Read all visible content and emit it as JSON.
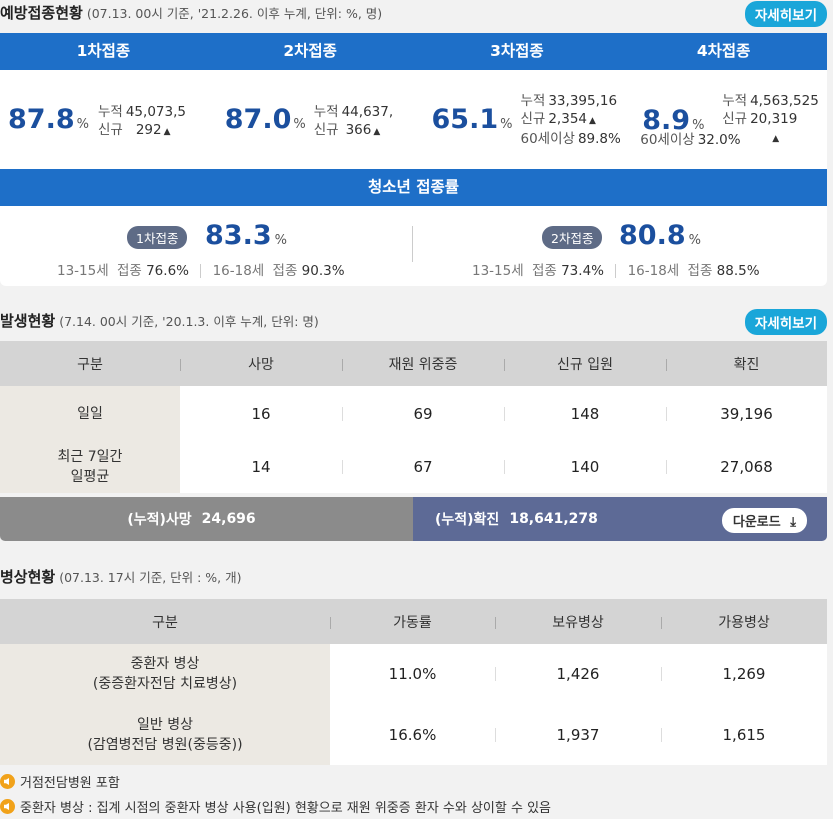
{
  "vaccination": {
    "title": "예방접종현황",
    "note": "(07.13. 00시 기준, '21.2.26. 이후 누계, 단위: %, 명)",
    "detail_btn": "자세히보기",
    "columns": [
      "1차접종",
      "2차접종",
      "3차접종",
      "4차접종"
    ],
    "doses": [
      {
        "rate": "87.8",
        "unit": "%",
        "cum_label": "누적",
        "cum": "45,073,5",
        "new_label": "신규",
        "new": "292"
      },
      {
        "rate": "87.0",
        "unit": "%",
        "cum_label": "누적",
        "cum": "44,637,",
        "new_label": "신규",
        "new": "366"
      },
      {
        "rate": "65.1",
        "unit": "%",
        "cum_label": "누적",
        "cum": "33,395,16",
        "new_label": "신규",
        "new": "2,354",
        "age_label": "60세이상",
        "age": "89.8%"
      },
      {
        "rate": "8.9",
        "unit": "%",
        "cum_label": "누적",
        "cum": "4,563,525",
        "new_label": "신규",
        "new": "20,319",
        "age_label": "60세이상",
        "age": "32.0%"
      }
    ],
    "teen_title": "청소년 접종률",
    "teen": [
      {
        "badge": "1차접종",
        "rate": "83.3",
        "unit": "%",
        "g1_label": "13-15세",
        "g1_kind": "접종",
        "g1": "76.6%",
        "g2_label": "16-18세",
        "g2_kind": "접종",
        "g2": "90.3%"
      },
      {
        "badge": "2차접종",
        "rate": "80.8",
        "unit": "%",
        "g1_label": "13-15세",
        "g1_kind": "접종",
        "g1": "73.4%",
        "g2_label": "16-18세",
        "g2_kind": "접종",
        "g2": "88.5%"
      }
    ]
  },
  "occurrence": {
    "title": "발생현황",
    "note": "(7.14. 00시 기준, '20.1.3. 이후 누계, 단위: 명)",
    "detail_btn": "자세히보기",
    "headers": [
      "구분",
      "사망",
      "재원 위중증",
      "신규 입원",
      "확진"
    ],
    "rows": [
      {
        "label": "일일",
        "values": [
          "16",
          "69",
          "148",
          "39,196"
        ]
      },
      {
        "label": "최근 7일간 일평균",
        "values": [
          "14",
          "67",
          "140",
          "27,068"
        ]
      }
    ],
    "cum_death_label": "(누적)사망",
    "cum_death": "24,696",
    "cum_confirm_label": "(누적)확진",
    "cum_confirm": "18,641,278",
    "download": "다운로드"
  },
  "beds": {
    "title": "병상현황",
    "note": "(07.13. 17시 기준, 단위 : %, 개)",
    "headers": [
      "구분",
      "가동률",
      "보유병상",
      "가용병상"
    ],
    "rows": [
      {
        "label1": "중환자 병상",
        "label2": "(중증환자전담 치료병상)",
        "values": [
          "11.0%",
          "1,426",
          "1,269"
        ]
      },
      {
        "label1": "일반 병상",
        "label2": "(감염병전담 병원(중등중))",
        "values": [
          "16.6%",
          "1,937",
          "1,615"
        ]
      }
    ],
    "notes": [
      "거점전담병원 포함",
      "중환자 병상 : 집계 시점의 중환자 병상 사용(입원) 현황으로 재원 위중증 환자 수와 상이할 수 있음"
    ]
  }
}
